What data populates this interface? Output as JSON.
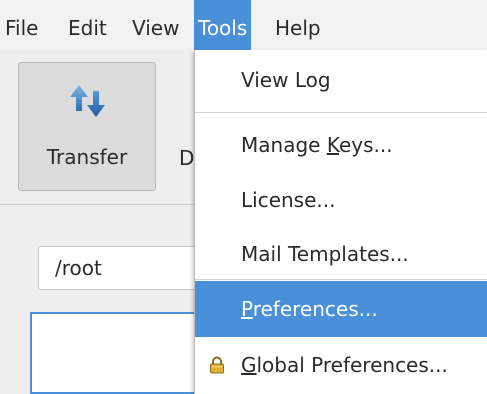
{
  "menubar": {
    "file": "File",
    "edit": "Edit",
    "view": "View",
    "tools": "Tools",
    "help": "Help"
  },
  "toolbar": {
    "transfer_label": "Transfer",
    "transfer_icon": "transfer-arrows-icon",
    "partial_label": "D"
  },
  "path": {
    "value": "/root"
  },
  "tools_menu": {
    "items": [
      {
        "label": "View Log"
      },
      {
        "pre": "Manage ",
        "mnemonic": "K",
        "post": "eys..."
      },
      {
        "label": "License..."
      },
      {
        "label": "Mail Templates..."
      },
      {
        "pre": "",
        "mnemonic": "P",
        "post": "references...",
        "highlighted": true
      },
      {
        "pre": "",
        "mnemonic": "G",
        "post": "lobal Preferences...",
        "icon": "lock-icon"
      }
    ]
  },
  "colors": {
    "accent": "#4a90d9",
    "background": "#efefef"
  }
}
